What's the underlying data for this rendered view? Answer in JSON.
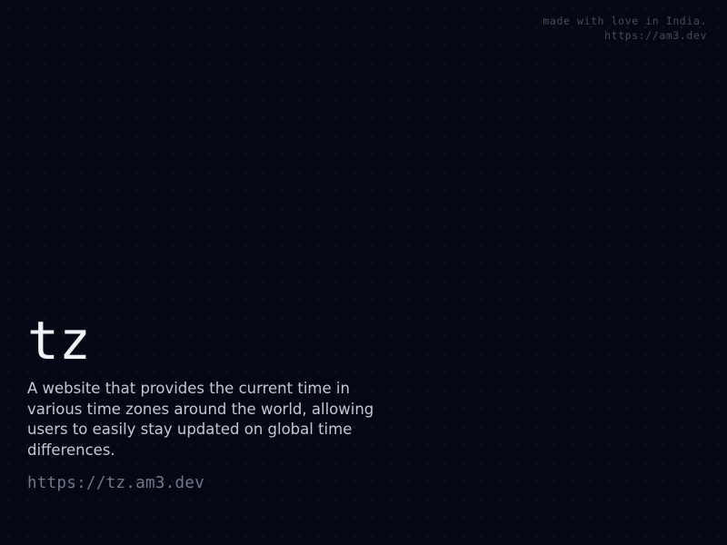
{
  "credits": {
    "line1": "made with love in India.",
    "line2": "https://am3.dev"
  },
  "hero": {
    "title": "tz",
    "description": "A website that provides the current time in various time zones around the world, allowing users to easily stay updated on global time differences.",
    "link": "https://tz.am3.dev"
  },
  "colors": {
    "background": "#050814",
    "title": "#f0f2f5",
    "text": "#c2c8d3",
    "muted": "#6f7889",
    "credits": "#464b57"
  }
}
